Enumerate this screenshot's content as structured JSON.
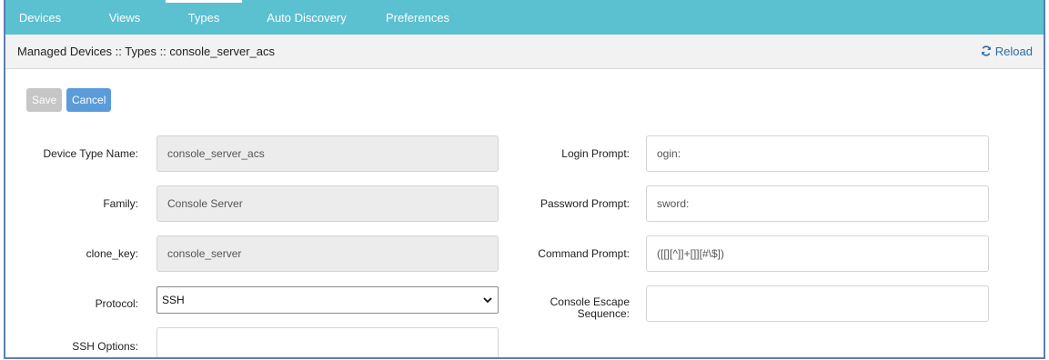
{
  "nav": {
    "tabs": [
      {
        "label": "Devices"
      },
      {
        "label": "Views"
      },
      {
        "label": "Types"
      },
      {
        "label": "Auto Discovery"
      },
      {
        "label": "Preferences"
      }
    ],
    "active": "Types"
  },
  "breadcrumb": "Managed Devices :: Types :: console_server_acs",
  "reload_label": "Reload",
  "buttons": {
    "save": "Save",
    "cancel": "Cancel"
  },
  "form": {
    "device_type_name": {
      "label": "Device Type Name:",
      "value": "console_server_acs"
    },
    "family": {
      "label": "Family:",
      "value": "Console Server"
    },
    "clone_key": {
      "label": "clone_key:",
      "value": "console_server"
    },
    "protocol": {
      "label": "Protocol:",
      "value": "SSH"
    },
    "ssh_options": {
      "label": "SSH Options:",
      "value": ""
    },
    "login_prompt": {
      "label": "Login Prompt:",
      "value": "ogin:"
    },
    "password_prompt": {
      "label": "Password Prompt:",
      "value": "sword:"
    },
    "command_prompt": {
      "label": "Command Prompt:",
      "value": "([[][^]]+[]][#\\$])"
    },
    "console_escape": {
      "label_line1": "Console Escape",
      "label_line2": "Sequence:",
      "value": ""
    }
  },
  "colors": {
    "nav_bg": "#5bc0cf",
    "link": "#2a6ca8",
    "cancel_bg": "#5b9bd9",
    "save_bg": "#c6c6c6"
  }
}
